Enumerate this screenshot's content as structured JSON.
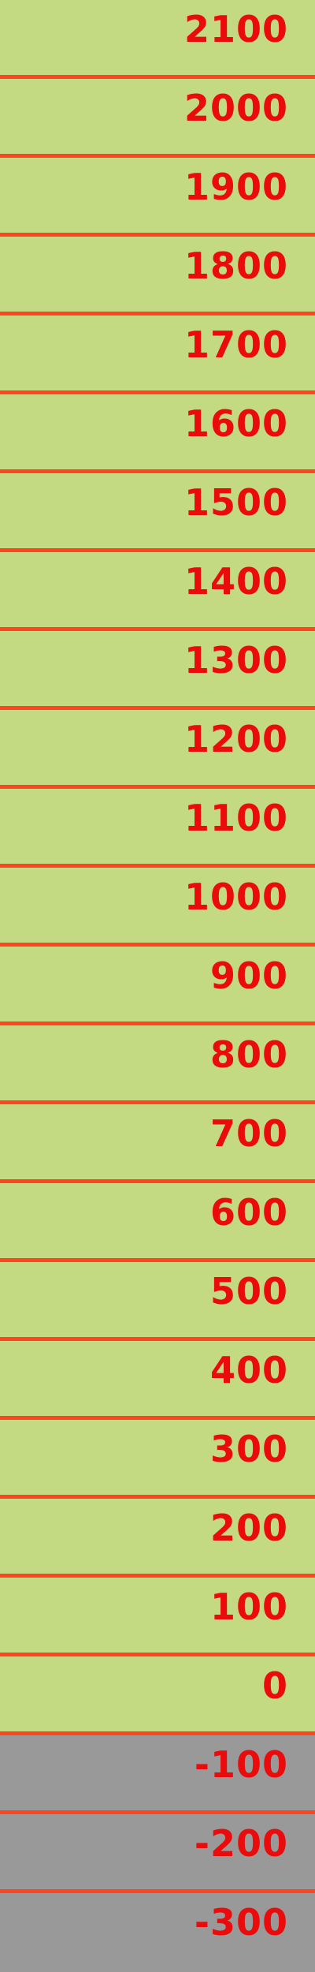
{
  "colors": {
    "positive_band": "#c3d982",
    "negative_band": "#999999",
    "divider": "#ff4422",
    "label": "#ea0c0c"
  },
  "bands": [
    {
      "label": "2100",
      "sign": "positive"
    },
    {
      "label": "2000",
      "sign": "positive"
    },
    {
      "label": "1900",
      "sign": "positive"
    },
    {
      "label": "1800",
      "sign": "positive"
    },
    {
      "label": "1700",
      "sign": "positive"
    },
    {
      "label": "1600",
      "sign": "positive"
    },
    {
      "label": "1500",
      "sign": "positive"
    },
    {
      "label": "1400",
      "sign": "positive"
    },
    {
      "label": "1300",
      "sign": "positive"
    },
    {
      "label": "1200",
      "sign": "positive"
    },
    {
      "label": "1100",
      "sign": "positive"
    },
    {
      "label": "1000",
      "sign": "positive"
    },
    {
      "label": "900",
      "sign": "positive"
    },
    {
      "label": "800",
      "sign": "positive"
    },
    {
      "label": "700",
      "sign": "positive"
    },
    {
      "label": "600",
      "sign": "positive"
    },
    {
      "label": "500",
      "sign": "positive"
    },
    {
      "label": "400",
      "sign": "positive"
    },
    {
      "label": "300",
      "sign": "positive"
    },
    {
      "label": "200",
      "sign": "positive"
    },
    {
      "label": "100",
      "sign": "positive"
    },
    {
      "label": "0",
      "sign": "positive"
    },
    {
      "label": "-100",
      "sign": "negative"
    },
    {
      "label": "-200",
      "sign": "negative"
    },
    {
      "label": "-300",
      "sign": "negative"
    }
  ]
}
